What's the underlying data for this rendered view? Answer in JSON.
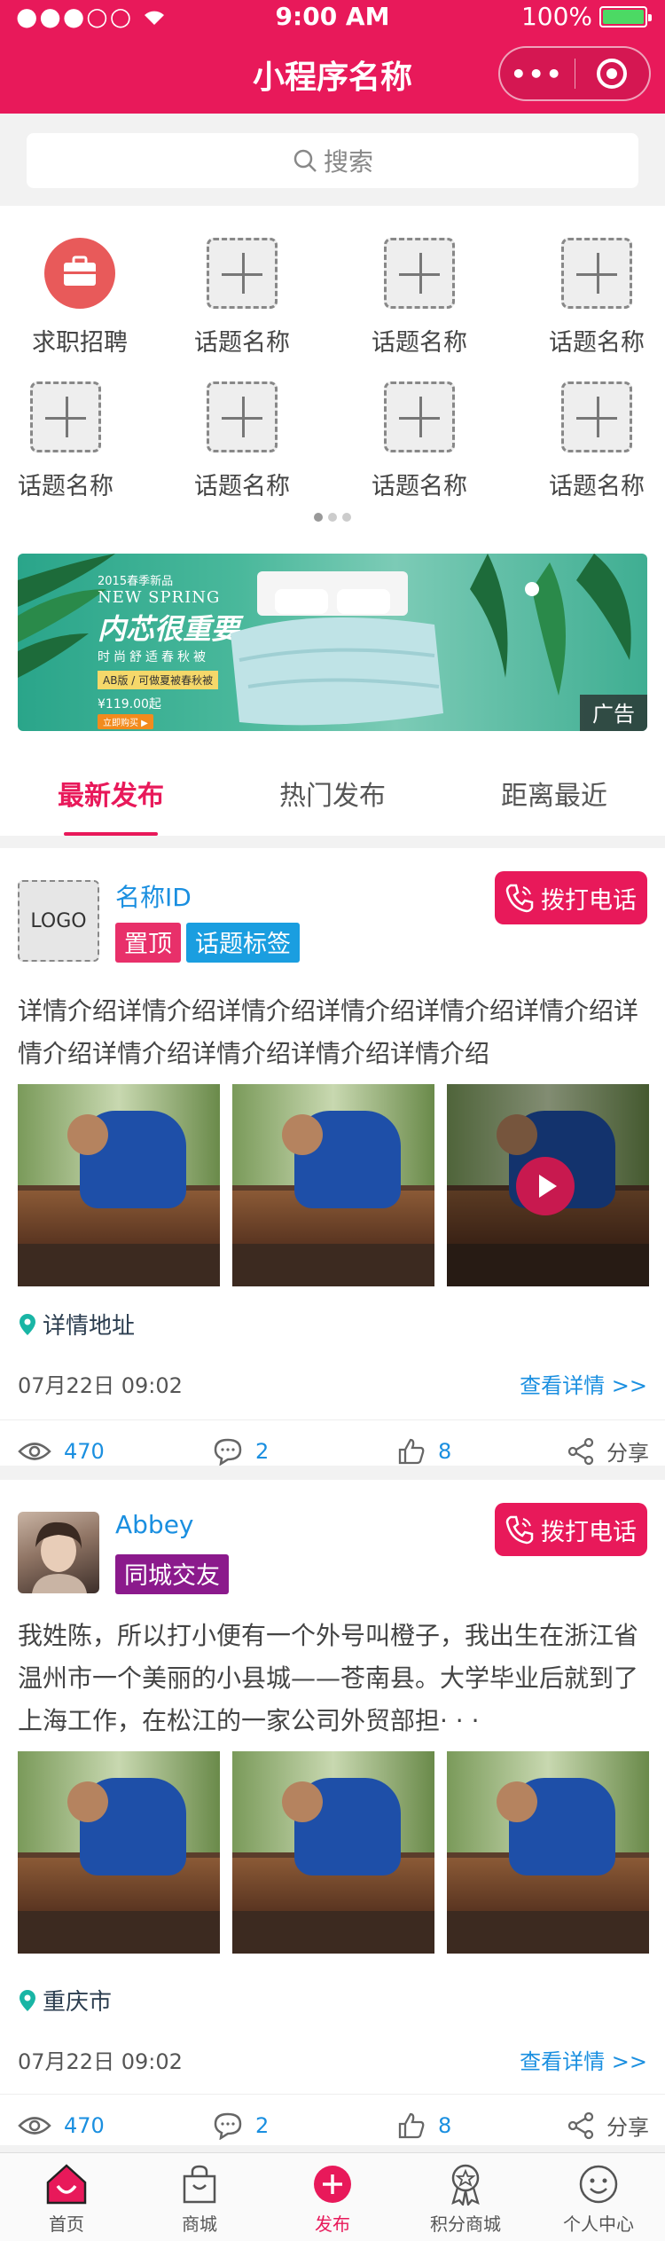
{
  "status": {
    "signal": "●●●○○",
    "time": "9:00 AM",
    "battery": "100%"
  },
  "nav": {
    "title": "小程序名称",
    "more": "•••"
  },
  "search": {
    "placeholder": "搜索"
  },
  "grid": {
    "items": [
      {
        "label": "求职招聘",
        "icon": "briefcase-icon"
      },
      {
        "label": "话题名称",
        "icon": "plus-icon"
      },
      {
        "label": "话题名称",
        "icon": "plus-icon"
      },
      {
        "label": "话题名称",
        "icon": "plus-icon"
      },
      {
        "label": "话题名称",
        "icon": "plus-icon"
      },
      {
        "label": "话题名称",
        "icon": "plus-icon"
      },
      {
        "label": "话题名称",
        "icon": "plus-icon"
      },
      {
        "label": "话题名称",
        "icon": "plus-icon"
      }
    ],
    "pages": 3,
    "current_page": 1
  },
  "banner": {
    "small": "2015春季新品",
    "en": "NEW SPRING",
    "headline": "内芯很重要",
    "sub": "时尚舒适春秋被",
    "strip": "AB版 / 可做夏被春秋被",
    "price": "¥119.00起",
    "buy": "立即购买 ▶",
    "ad": "广告"
  },
  "tabs": [
    {
      "label": "最新发布",
      "active": true
    },
    {
      "label": "热门发布",
      "active": false
    },
    {
      "label": "距离最近",
      "active": false
    }
  ],
  "posts": [
    {
      "avatar_text": "LOGO",
      "name": "名称ID",
      "tags": [
        {
          "text": "置顶",
          "color": "#e8306a"
        },
        {
          "text": "话题标签",
          "color": "#1a9ee0"
        }
      ],
      "call": "拨打电话",
      "desc": "详情介绍详情介绍详情介绍详情介绍详情介绍详情介绍详情介绍详情介绍详情介绍详情介绍详情介绍",
      "address": "详情地址",
      "date": "07月22日 09:02",
      "more": "查看详情 >>",
      "views": "470",
      "comments": "2",
      "likes": "8",
      "share": "分享"
    },
    {
      "avatar_text": "",
      "name": "Abbey",
      "tags": [
        {
          "text": "同城交友",
          "color": "#8b1a8c"
        }
      ],
      "call": "拨打电话",
      "desc": "我姓陈，所以打小便有一个外号叫橙子，我出生在浙江省温州市一个美丽的小县城——苍南县。大学毕业后就到了上海工作，在松江的一家公司外贸部担· · ·",
      "address": "重庆市",
      "date": "07月22日 09:02",
      "more": "查看详情 >>",
      "views": "470",
      "comments": "2",
      "likes": "8",
      "share": "分享"
    }
  ],
  "tabbar": [
    {
      "label": "首页",
      "icon": "home-icon",
      "active": false
    },
    {
      "label": "商城",
      "icon": "shopping-bag-icon",
      "active": false
    },
    {
      "label": "发布",
      "icon": "publish-plus-icon",
      "active": true
    },
    {
      "label": "积分商城",
      "icon": "medal-icon",
      "active": false
    },
    {
      "label": "个人中心",
      "icon": "smiley-icon",
      "active": false
    }
  ],
  "colors": {
    "brand": "#e8195a",
    "link": "#1a8fe0"
  }
}
